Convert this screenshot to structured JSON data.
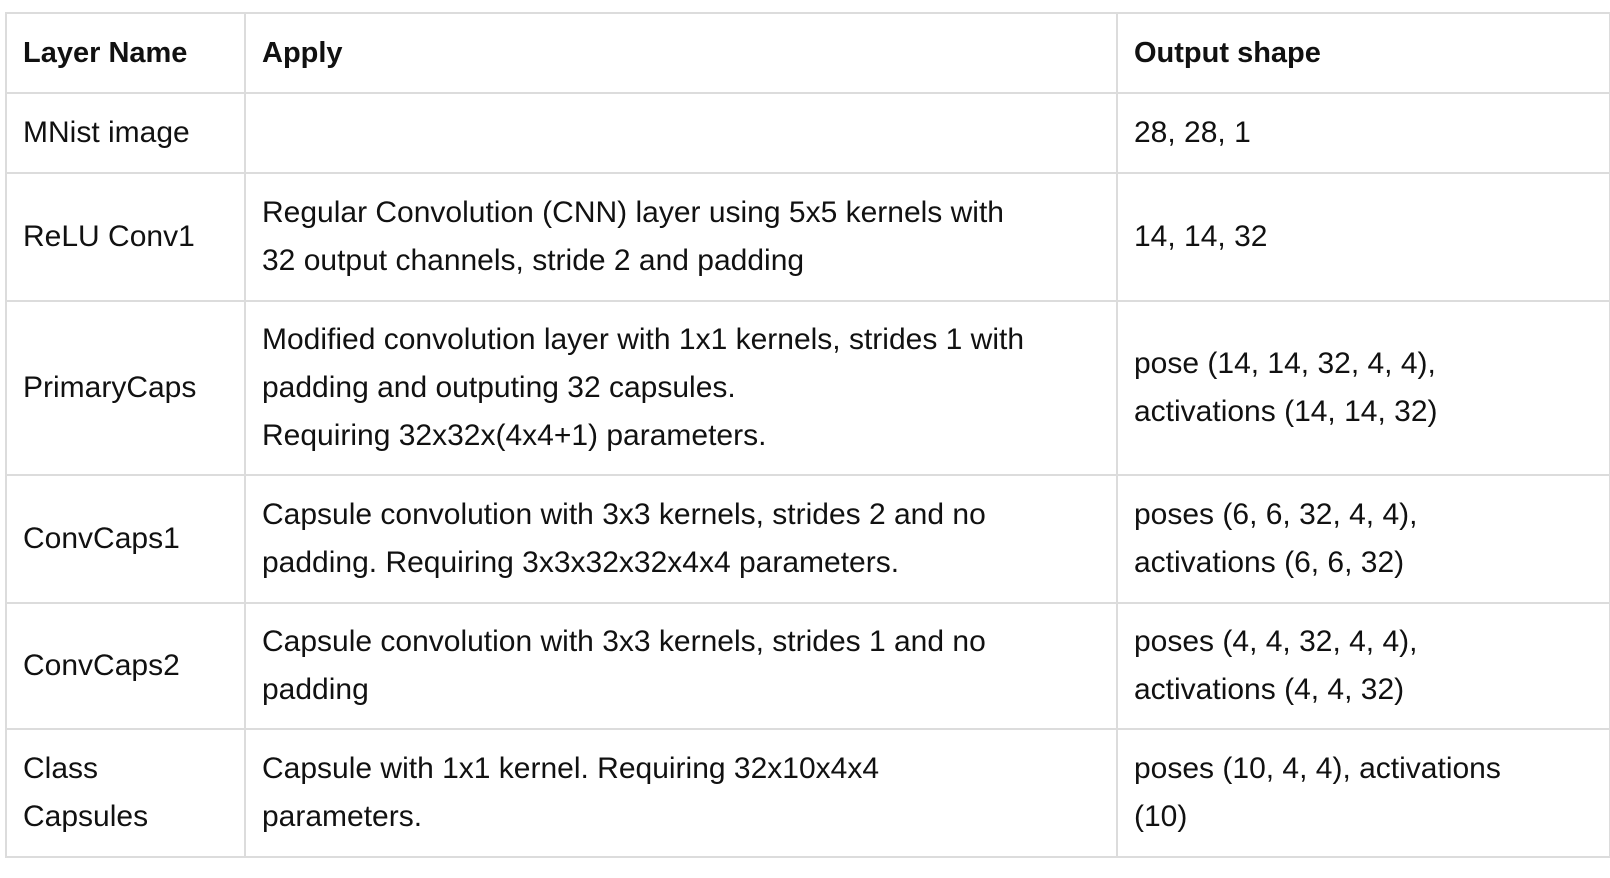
{
  "table": {
    "headers": [
      "Layer Name",
      "Apply",
      "Output shape"
    ],
    "rows": [
      {
        "layer": [
          "MNist image"
        ],
        "apply": [],
        "output": [
          "28, 28, 1"
        ]
      },
      {
        "layer": [
          "ReLU Conv1"
        ],
        "apply": [
          "Regular Convolution (CNN) layer using 5x5 kernels with",
          "32 output channels, stride 2 and padding"
        ],
        "output": [
          "14, 14, 32"
        ]
      },
      {
        "layer": [
          "PrimaryCaps"
        ],
        "apply": [
          "Modified convolution layer with 1x1 kernels, strides 1 with",
          "padding and outputing 32 capsules.",
          "Requiring 32x32x(4x4+1) parameters."
        ],
        "output": [
          "pose (14, 14, 32, 4, 4),",
          "activations (14, 14, 32)"
        ]
      },
      {
        "layer": [
          "ConvCaps1"
        ],
        "apply": [
          "Capsule convolution with 3x3 kernels, strides 2 and no",
          "padding. Requiring 3x3x32x32x4x4 parameters."
        ],
        "output": [
          "poses (6, 6, 32, 4, 4),",
          "activations (6, 6, 32)"
        ]
      },
      {
        "layer": [
          "ConvCaps2"
        ],
        "apply": [
          "Capsule convolution with 3x3 kernels, strides 1 and no",
          "padding"
        ],
        "output": [
          "poses (4, 4, 32, 4, 4),",
          "activations (4, 4, 32)"
        ]
      },
      {
        "layer": [
          "Class",
          "Capsules"
        ],
        "apply": [
          "Capsule with 1x1 kernel. Requiring 32x10x4x4",
          "parameters."
        ],
        "output": [
          "poses (10, 4, 4), activations",
          "(10)"
        ]
      }
    ]
  }
}
